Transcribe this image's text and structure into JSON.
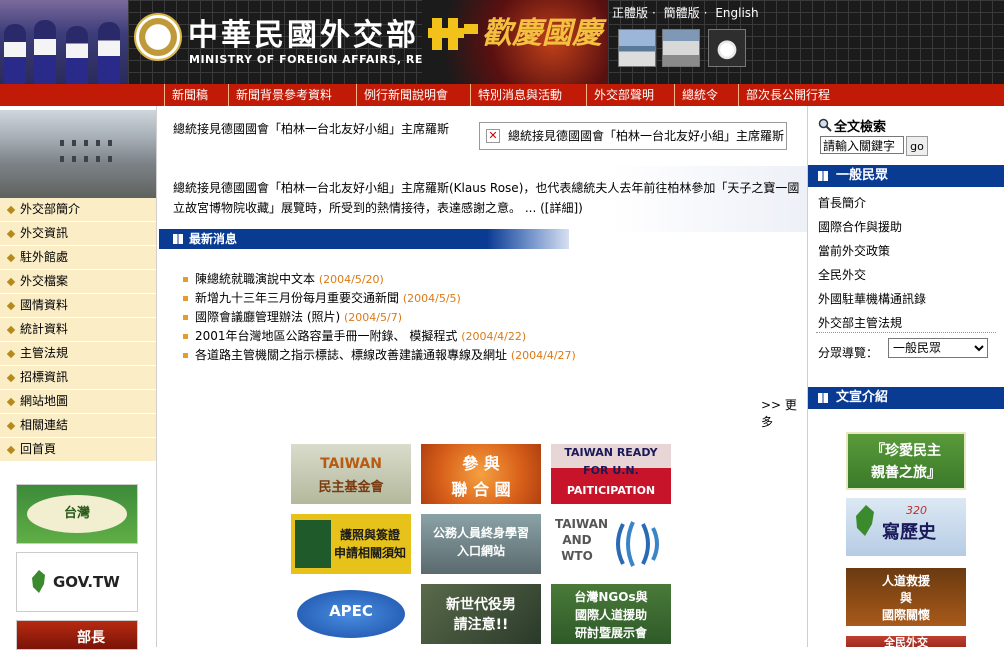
{
  "header": {
    "title": "中華民國外交部",
    "subtitle": "MINISTRY OF FOREIGN AFFAIRS, REPUBLIC OF CHINA",
    "celebration_text": "歡慶國慶",
    "languages": [
      "正體版",
      "簡體版",
      "English"
    ]
  },
  "top_nav": [
    "新聞稿",
    "新聞背景參考資料",
    "例行新聞說明會",
    "特別消息與活動",
    "外交部聲明",
    "總統令",
    "部次長公開行程"
  ],
  "left_nav": [
    "外交部簡介",
    "外交資訊",
    "駐外館處",
    "外交檔案",
    "國情資料",
    "統計資料",
    "主管法規",
    "招標資訊",
    "網站地圖",
    "相關連結",
    "回首頁"
  ],
  "left_banners": {
    "banner1": "台灣",
    "banner2": "GOV.TW",
    "banner3": "部長"
  },
  "main": {
    "headline": "總統接見德國國會「柏林一台北友好小組」主席羅斯",
    "image_alt": "總統接見德國國會「柏林一台北友好小組」主席羅斯",
    "summary": "總統接見德國國會「柏林一台北友好小組」主席羅斯(Klaus Rose)，也代表總統夫人去年前往柏林參加「天子之寶一國立故宮博物院收藏」展覽時，所受到的熱情接待，表達感謝之意。 ... ([詳細])",
    "news_title": "最新消息",
    "news": [
      {
        "text": "陳總統就職演說中文本",
        "date": "(2004/5/20)"
      },
      {
        "text": "新增九十三年三月份每月重要交通新聞",
        "date": "(2004/5/5)"
      },
      {
        "text": "國際會議廳管理辦法 (照片)",
        "date": "(2004/5/7)"
      },
      {
        "text": "2001年台灣地區公路容量手冊一附錄、 模擬程式",
        "date": "(2004/4/22)"
      },
      {
        "text": "各道路主管機關之指示標誌、標線改善建議通報專線及網址",
        "date": "(2004/4/27)"
      }
    ],
    "more": ">> 更多",
    "tiles": [
      {
        "line1": "TAIWAN",
        "line2": "民主基金會"
      },
      {
        "line1": "參 與",
        "line2": "聯 合 國"
      },
      {
        "line1": "TAIWAN READY",
        "line2": "FOR U.N.",
        "line3": "PAITICIPATION"
      },
      {
        "line1": "護照與簽證",
        "line2": "申請相關須知"
      },
      {
        "line1": "公務人員終身學習",
        "line2": "入口網站"
      },
      {
        "line1": "TAIWAN",
        "line2": "AND",
        "line3": "WTO"
      },
      {
        "line1": "APEC"
      },
      {
        "line1": "新世代役男",
        "line2": "請注意!!"
      },
      {
        "line1": "台灣NGOs與",
        "line2": "國際人道援助",
        "line3": "研討暨展示會"
      }
    ]
  },
  "right": {
    "search_title": "全文檢索",
    "search_value": "請輸入關鍵字",
    "go": "go",
    "general_title": "一般民眾",
    "general_links": [
      "首長簡介",
      "國際合作與援助",
      "當前外交政策",
      "全民外交",
      "外國駐華機構通訊錄",
      "外交部主管法規"
    ],
    "audience_label": "分眾導覽：",
    "audience_value": "一般民眾",
    "promo_title": "文宣介紹",
    "promos": [
      {
        "line1": "『珍愛民主",
        "line2": "親善之旅』"
      },
      {
        "line1": "320",
        "line2": "寫歷史"
      },
      {
        "line1": "人道救援",
        "line2": "與",
        "line3": "國際關懷"
      },
      {
        "line1": "全民外交"
      }
    ]
  },
  "colors": {
    "nav_red": "#c11a06",
    "section_blue": "#0a3b93",
    "date_orange": "#d97a17",
    "left_nav_bg": "#fbeec7"
  }
}
